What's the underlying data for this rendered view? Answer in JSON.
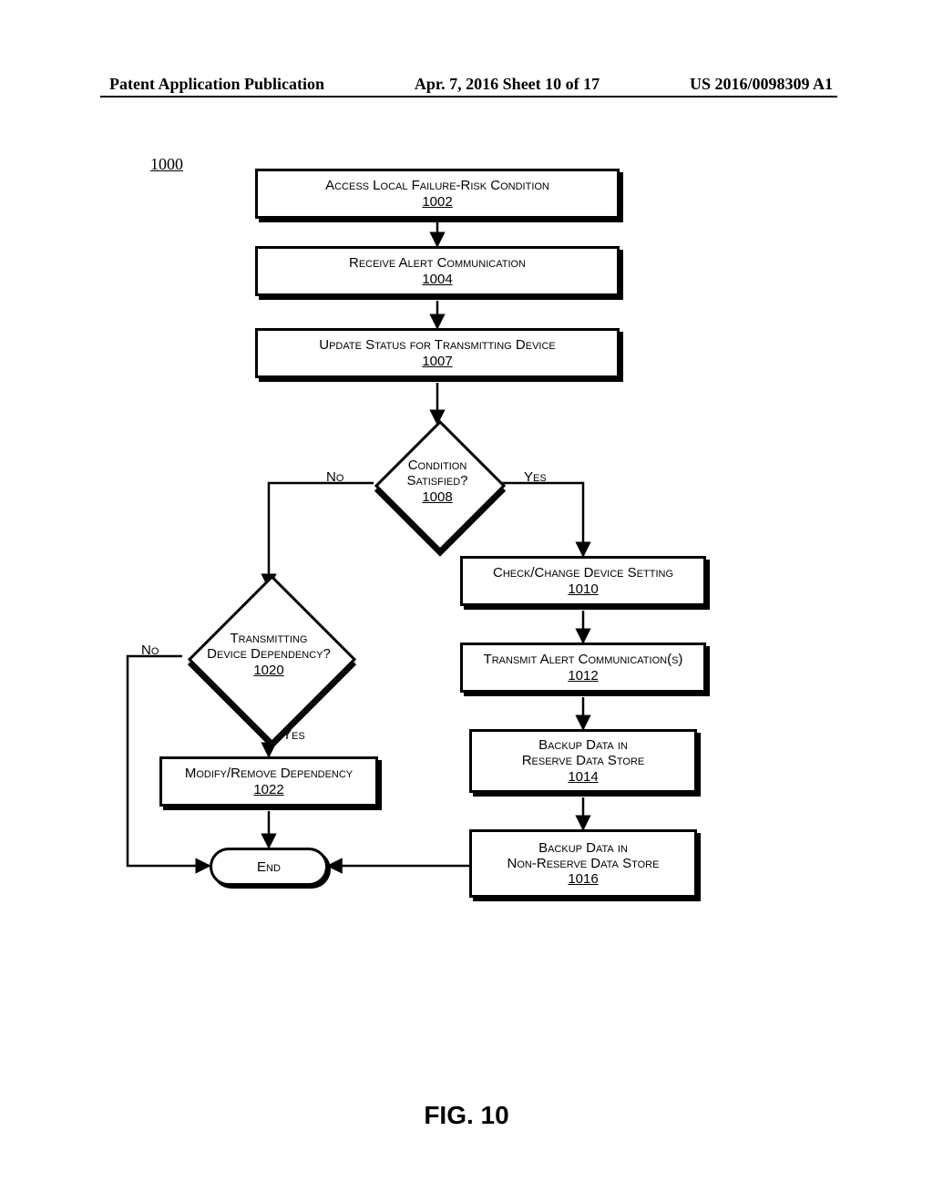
{
  "header": {
    "left": "Patent Application Publication",
    "mid": "Apr. 7, 2016  Sheet 10 of 17",
    "right": "US 2016/0098309 A1"
  },
  "figure": {
    "id_label": "1000",
    "caption": "FIG. 10"
  },
  "boxes": {
    "b1002_text": "Access Local Failure-Risk Condition",
    "b1002_ref": "1002",
    "b1004_text": "Receive Alert Communication",
    "b1004_ref": "1004",
    "b1007_text": "Update Status for Transmitting Device",
    "b1007_ref": "1007",
    "b1010_text": "Check/Change Device Setting",
    "b1010_ref": "1010",
    "b1012_text": "Transmit Alert Communication(s)",
    "b1012_ref": "1012",
    "b1014_l1": "Backup Data in",
    "b1014_l2": "Reserve Data Store",
    "b1014_ref": "1014",
    "b1016_l1": "Backup Data in",
    "b1016_l2": "Non-Reserve Data Store",
    "b1016_ref": "1016",
    "b1022_text": "Modify/Remove Dependency",
    "b1022_ref": "1022",
    "end_text": "End"
  },
  "diamonds": {
    "d1008_l1": "Condition",
    "d1008_l2": "Satisfied?",
    "d1008_ref": "1008",
    "d1020_l1": "Transmitting",
    "d1020_l2": "Device Dependency?",
    "d1020_ref": "1020"
  },
  "labels": {
    "no_1008": "No",
    "yes_1008": "Yes",
    "no_1020": "No",
    "yes_1020": "Yes"
  },
  "chart_data": {
    "type": "flowchart",
    "title": "FIG. 10",
    "figure_id": "1000",
    "nodes": [
      {
        "id": "1002",
        "type": "process",
        "label": "Access Local Failure-Risk Condition"
      },
      {
        "id": "1004",
        "type": "process",
        "label": "Receive Alert Communication"
      },
      {
        "id": "1007",
        "type": "process",
        "label": "Update Status for Transmitting Device"
      },
      {
        "id": "1008",
        "type": "decision",
        "label": "Condition Satisfied?"
      },
      {
        "id": "1010",
        "type": "process",
        "label": "Check/Change Device Setting"
      },
      {
        "id": "1012",
        "type": "process",
        "label": "Transmit Alert Communication(s)"
      },
      {
        "id": "1014",
        "type": "process",
        "label": "Backup Data in Reserve Data Store"
      },
      {
        "id": "1016",
        "type": "process",
        "label": "Backup Data in Non-Reserve Data Store"
      },
      {
        "id": "1020",
        "type": "decision",
        "label": "Transmitting Device Dependency?"
      },
      {
        "id": "1022",
        "type": "process",
        "label": "Modify/Remove Dependency"
      },
      {
        "id": "END",
        "type": "terminator",
        "label": "End"
      }
    ],
    "edges": [
      {
        "from": "1002",
        "to": "1004"
      },
      {
        "from": "1004",
        "to": "1007"
      },
      {
        "from": "1007",
        "to": "1008"
      },
      {
        "from": "1008",
        "to": "1010",
        "label": "Yes"
      },
      {
        "from": "1008",
        "to": "1020",
        "label": "No"
      },
      {
        "from": "1010",
        "to": "1012"
      },
      {
        "from": "1012",
        "to": "1014"
      },
      {
        "from": "1014",
        "to": "1016"
      },
      {
        "from": "1016",
        "to": "END"
      },
      {
        "from": "1020",
        "to": "1022",
        "label": "Yes"
      },
      {
        "from": "1020",
        "to": "END",
        "label": "No"
      },
      {
        "from": "1022",
        "to": "END"
      }
    ]
  }
}
